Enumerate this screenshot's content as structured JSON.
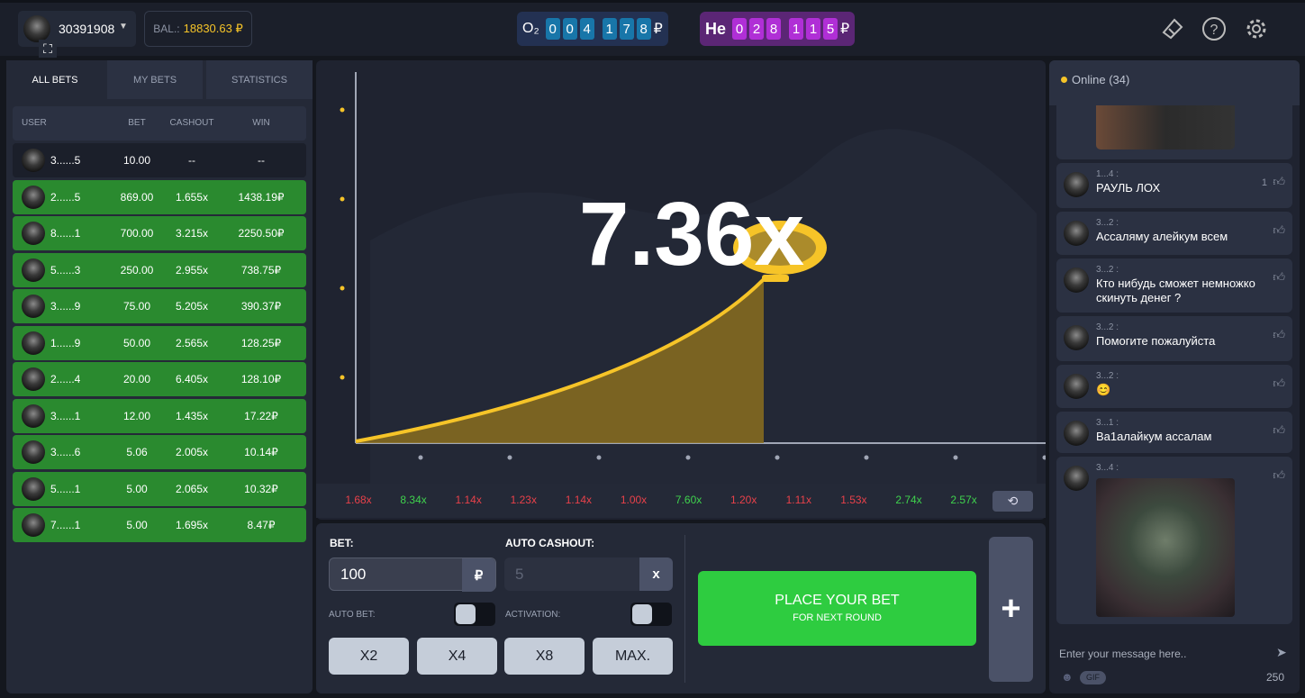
{
  "header": {
    "username": "30391908",
    "balance_label": "BAL.:",
    "balance_value": "18830.63 ₽",
    "o2": {
      "symbol": "O₂",
      "digits": [
        "0",
        "0",
        "4",
        "1",
        "7",
        "8"
      ],
      "currency": "₽",
      "color": "#1876a9"
    },
    "he": {
      "symbol": "He",
      "digits": [
        "0",
        "2",
        "8",
        "1",
        "1",
        "5"
      ],
      "currency": "₽",
      "color": "#b02fd6"
    },
    "icons": [
      "ticket-icon",
      "help-icon",
      "gear-icon"
    ]
  },
  "bets": {
    "tabs": [
      "ALL BETS",
      "MY BETS",
      "STATISTICS"
    ],
    "active_tab": "ALL BETS",
    "columns": [
      "USER",
      "BET",
      "CASHOUT",
      "WIN"
    ],
    "rows": [
      {
        "user": "3......5",
        "bet": "10.00",
        "cashout": "--",
        "win": "--"
      },
      {
        "user": "2......5",
        "bet": "869.00",
        "cashout": "1.655x",
        "win": "1438.19₽"
      },
      {
        "user": "8......1",
        "bet": "700.00",
        "cashout": "3.215x",
        "win": "2250.50₽"
      },
      {
        "user": "5......3",
        "bet": "250.00",
        "cashout": "2.955x",
        "win": "738.75₽"
      },
      {
        "user": "3......9",
        "bet": "75.00",
        "cashout": "5.205x",
        "win": "390.37₽"
      },
      {
        "user": "1......9",
        "bet": "50.00",
        "cashout": "2.565x",
        "win": "128.25₽"
      },
      {
        "user": "2......4",
        "bet": "20.00",
        "cashout": "6.405x",
        "win": "128.10₽"
      },
      {
        "user": "3......1",
        "bet": "12.00",
        "cashout": "1.435x",
        "win": "17.22₽"
      },
      {
        "user": "3......6",
        "bet": "5.06",
        "cashout": "2.005x",
        "win": "10.14₽"
      },
      {
        "user": "5......1",
        "bet": "5.00",
        "cashout": "2.065x",
        "win": "10.32₽"
      },
      {
        "user": "7......1",
        "bet": "5.00",
        "cashout": "1.695x",
        "win": "8.47₽"
      }
    ]
  },
  "game": {
    "multiplier": "7.36x",
    "curve_color": "#f6c428",
    "history": [
      {
        "v": "1.68x",
        "c": "red"
      },
      {
        "v": "8.34x",
        "c": "green"
      },
      {
        "v": "1.14x",
        "c": "red"
      },
      {
        "v": "1.23x",
        "c": "red"
      },
      {
        "v": "1.14x",
        "c": "red"
      },
      {
        "v": "1.00x",
        "c": "red"
      },
      {
        "v": "7.60x",
        "c": "green"
      },
      {
        "v": "1.20x",
        "c": "red"
      },
      {
        "v": "1.11x",
        "c": "red"
      },
      {
        "v": "1.53x",
        "c": "red"
      },
      {
        "v": "2.74x",
        "c": "green"
      },
      {
        "v": "2.57x",
        "c": "green"
      }
    ]
  },
  "betpanel": {
    "bet_label": "BET:",
    "bet_value": "100",
    "bet_suffix": "₽",
    "cashout_label": "AUTO CASHOUT:",
    "cashout_placeholder": "5",
    "cashout_suffix": "x",
    "auto_bet_label": "AUTO BET:",
    "activation_label": "ACTIVATION:",
    "auto_bet_on": false,
    "activation_on": false,
    "quick": [
      "X2",
      "X4",
      "X8",
      "MAX."
    ],
    "place_title": "PLACE YOUR BET",
    "place_sub": "FOR NEXT ROUND",
    "place_color": "#2ecc40",
    "add_label": "+"
  },
  "chat": {
    "online": "Online (34)",
    "messages": [
      {
        "user": "1...4 :",
        "text": "РАУЛЬ ЛОХ",
        "likes": "1"
      },
      {
        "user": "3...2 :",
        "text": "Ассаляму алейкум всем",
        "likes": ""
      },
      {
        "user": "3...2 :",
        "text": "Кто нибудь сможет немножко скинуть денег ?",
        "likes": ""
      },
      {
        "user": "3...2 :",
        "text": "Помогите пожалуйста",
        "likes": ""
      },
      {
        "user": "3...2 :",
        "text": "😊",
        "likes": ""
      },
      {
        "user": "3...1 :",
        "text": "Ва1алайкум ассалам",
        "likes": ""
      },
      {
        "user": "3...4 :",
        "text": "",
        "likes": ""
      }
    ],
    "placeholder": "Enter your message here..",
    "gif": "GIF",
    "remaining": "250"
  }
}
